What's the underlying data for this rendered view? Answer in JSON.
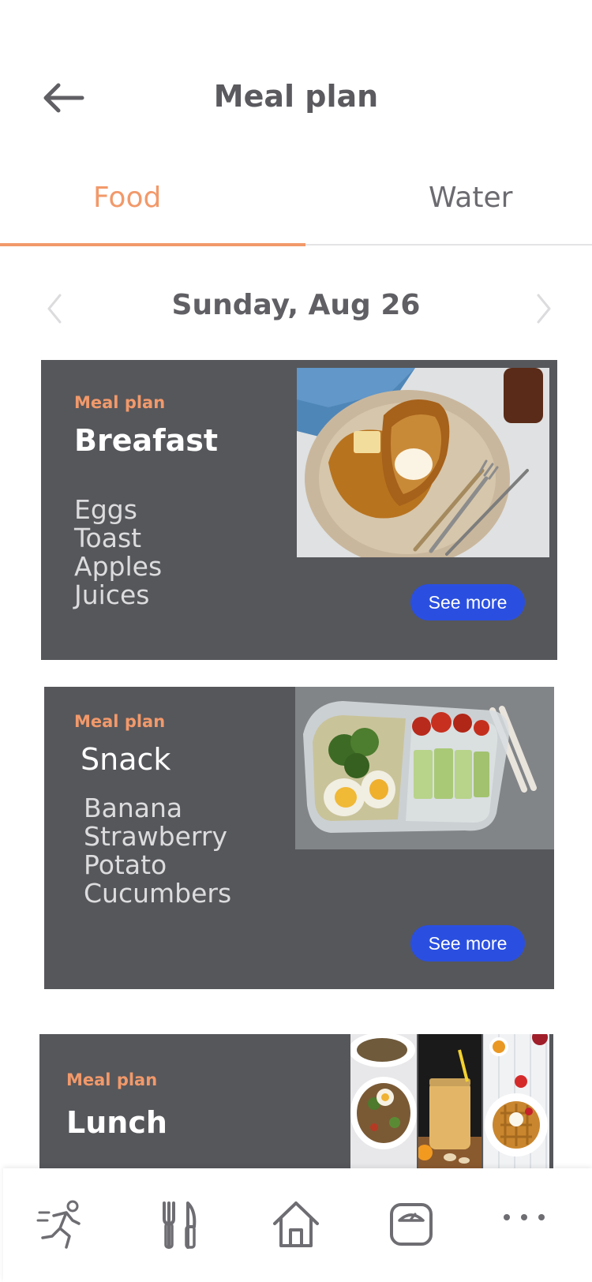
{
  "header": {
    "title": "Meal plan"
  },
  "tabs": [
    {
      "label": "Food",
      "active": true
    },
    {
      "label": "Water",
      "active": false
    }
  ],
  "date": {
    "label": "Sunday, Aug 26"
  },
  "meals": [
    {
      "subtitle": "Meal plan",
      "title": "Breafast",
      "items": [
        "Eggs",
        "Toast",
        "Apples",
        "Juices"
      ],
      "button": "See more"
    },
    {
      "subtitle": "Meal plan",
      "title": "Snack",
      "items": [
        "Banana",
        "Strawberry",
        "Potato",
        "Cucumbers"
      ],
      "button": "See more"
    },
    {
      "subtitle": "Meal  plan",
      "title": "Lunch"
    }
  ],
  "bottom_nav": [
    {
      "icon": "running-icon"
    },
    {
      "icon": "utensils-icon"
    },
    {
      "icon": "home-icon"
    },
    {
      "icon": "scale-icon"
    },
    {
      "icon": "more-icon"
    }
  ],
  "colors": {
    "accent": "#f2996a",
    "card": "#56575b",
    "button": "#2a4fe0",
    "text": "#5a5a5f"
  }
}
